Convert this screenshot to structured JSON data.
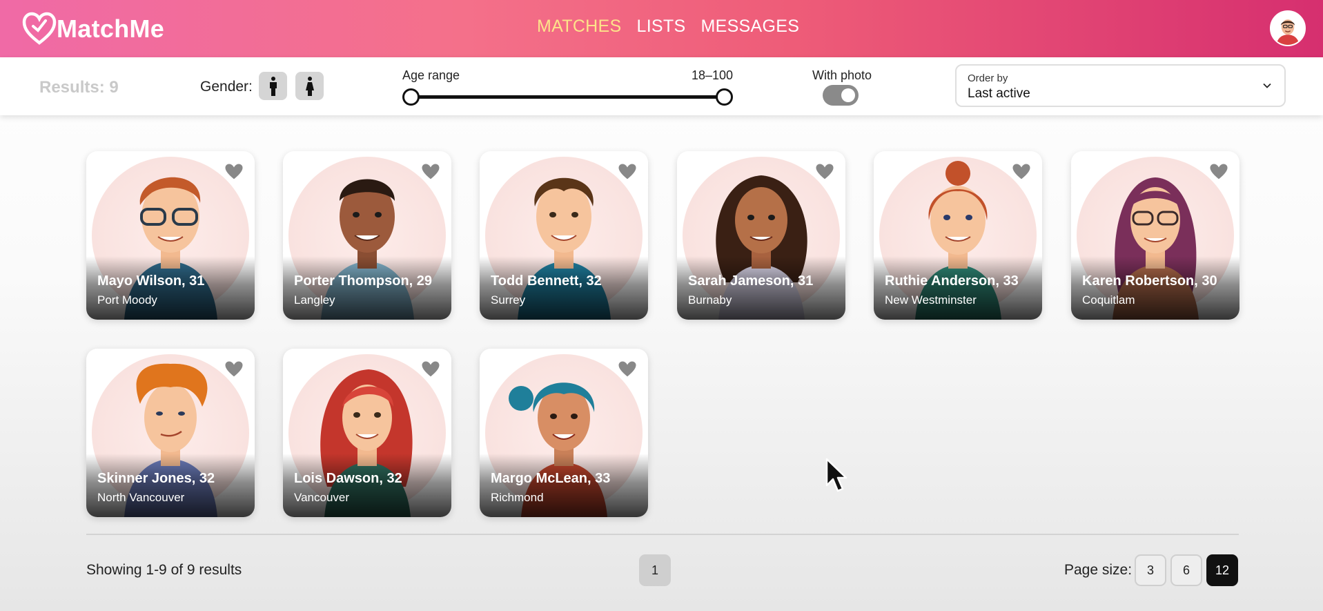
{
  "app": {
    "name": "MatchMe"
  },
  "nav": {
    "links": [
      {
        "label": "MATCHES",
        "active": true
      },
      {
        "label": "LISTS",
        "active": false
      },
      {
        "label": "MESSAGES",
        "active": false
      }
    ]
  },
  "filters": {
    "results_label": "Results: 9",
    "gender_label": "Gender:",
    "gender_icons": [
      "male-icon",
      "female-icon"
    ],
    "age_label": "Age range",
    "age_value": "18–100",
    "age_min": 18,
    "age_max": 100,
    "with_photo_label": "With photo",
    "with_photo_on": true,
    "order_by_label": "Order by",
    "order_by_value": "Last active"
  },
  "members": [
    {
      "name": "Mayo Wilson, 31",
      "city": "Port Moody"
    },
    {
      "name": "Porter Thompson, 29",
      "city": "Langley"
    },
    {
      "name": "Todd Bennett, 32",
      "city": "Surrey"
    },
    {
      "name": "Sarah Jameson, 31",
      "city": "Burnaby"
    },
    {
      "name": "Ruthie Anderson, 33",
      "city": "New Westminster"
    },
    {
      "name": "Karen Robertson, 30",
      "city": "Coquitlam"
    },
    {
      "name": "Skinner Jones, 32",
      "city": "North Vancouver"
    },
    {
      "name": "Lois Dawson, 32",
      "city": "Vancouver"
    },
    {
      "name": "Margo McLean, 33",
      "city": "Richmond"
    }
  ],
  "pagination": {
    "showing": "Showing 1-9 of 9 results",
    "current_page": "1",
    "page_size_label": "Page size:",
    "page_sizes": [
      "3",
      "6",
      "12"
    ],
    "active_page_size": "12"
  },
  "colors": {
    "nav_active": "#fde38a",
    "header_start": "#f06aa6",
    "header_end": "#d62f6f"
  }
}
